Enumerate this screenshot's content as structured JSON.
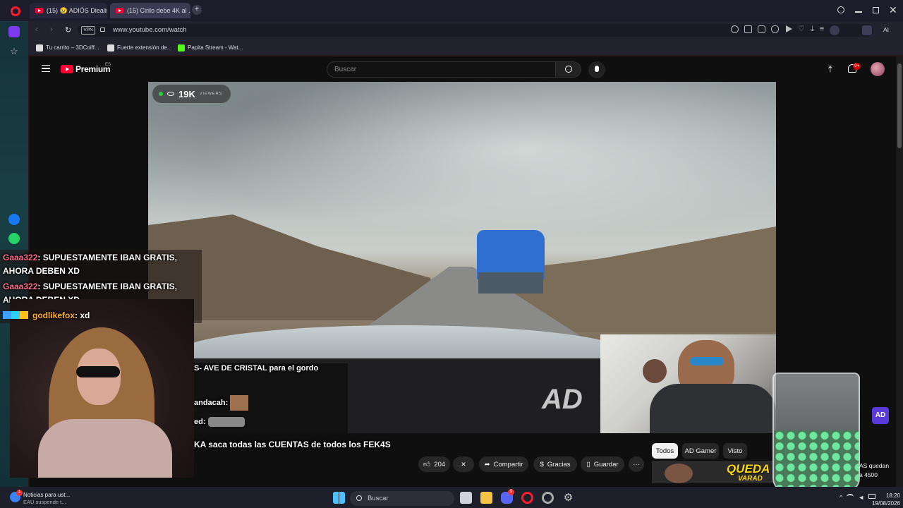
{
  "browser": {
    "tabs": [
      {
        "label": "(15) 😢 ADIÓS Diealis ¡FE…",
        "active": false
      },
      {
        "label": "(15) Cirilo debe 4K al …",
        "active": true
      }
    ],
    "new_tab": "+",
    "url": "www.youtube.com/watch",
    "vpn_badge": "VPN",
    "ai_label": "AI",
    "bookmarks": [
      "Tu carrito – 3DCoiff...",
      "Fuerte extensión de...",
      "Papita Stream - Wat..."
    ]
  },
  "youtube": {
    "logo_text": "Premium",
    "region": "ES",
    "search_placeholder": "Buscar",
    "notifications_badge": "9+",
    "viewers_count": "19K",
    "viewers_label": "VIEWERS",
    "watermark": "AD",
    "actions": {
      "likes": "204",
      "share": "Compartir",
      "thanks": "Gracias",
      "save": "Guardar",
      "more": "···"
    },
    "chips": [
      "Todos",
      "AD Gamer",
      "Visto"
    ],
    "active_chip": "Todos",
    "related_thumb_text": "QUEDA",
    "related_thumb_text2": "VARAD",
    "related_title_line1": "AS quedan",
    "related_title_line2": "a 4500"
  },
  "overlay": {
    "chat": [
      {
        "user": "Gaaa322",
        "message": ": SUPUESTAMENTE IBAN GRATIS,",
        "cont": "AHORA DEBEN XD"
      },
      {
        "user": "Gaaa322",
        "message": ": SUPUESTAMENTE IBAN GRATIS,",
        "cont": "AHORA DEBEN XD"
      },
      {
        "user": "godlikefox",
        "message": ": xd"
      }
    ],
    "bottom_chat": [
      "S- AVE DE CRISTAL para el gordo",
      "andacah:",
      "ed:",
      "KA saca todas las CUENTAS de todos los FEK4S"
    ],
    "channel_badge": "AD"
  },
  "taskbar": {
    "news_title": "Noticias para ust...",
    "news_subtitle": "EAU suspende t...",
    "news_badge": "1",
    "search_placeholder": "Buscar",
    "discord_badge": "9",
    "time": "18:20",
    "date": "19/08/2026"
  },
  "colors": {
    "user_color": "#ff6b8a",
    "user2_color": "#ffb020",
    "yt_red": "#ff0033",
    "opera_red": "#ff1b2d"
  }
}
